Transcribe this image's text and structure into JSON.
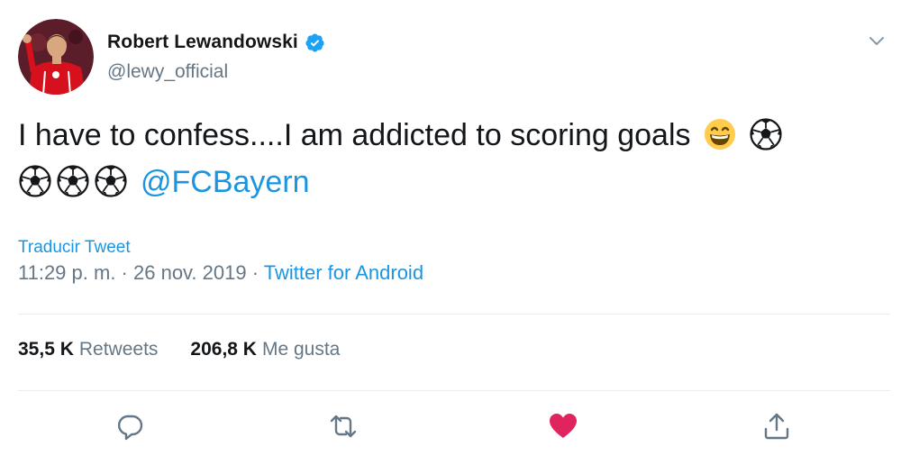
{
  "tweet": {
    "author_name": "Robert Lewandowski",
    "handle": "@lewy_official",
    "text": "I have to confess....I am addicted to scoring goals",
    "mention": "@FCBayern",
    "translate_label": "Traducir Tweet",
    "time": "11:29 p. m.",
    "date": "26 nov. 2019",
    "source": "Twitter for Android",
    "separator": " · "
  },
  "stats": {
    "retweets_count": "35,5 K",
    "retweets_label": "Retweets",
    "likes_count": "206,8 K",
    "likes_label": "Me gusta"
  },
  "icons": {
    "verified": "verified-badge-icon",
    "caret": "chevron-down-icon",
    "reply": "reply-icon",
    "retweet": "retweet-icon",
    "like": "heart-icon",
    "share": "share-icon"
  },
  "colors": {
    "link": "#1b95e0",
    "muted": "#657786",
    "like": "#e0245e",
    "verified": "#1da1f2"
  }
}
